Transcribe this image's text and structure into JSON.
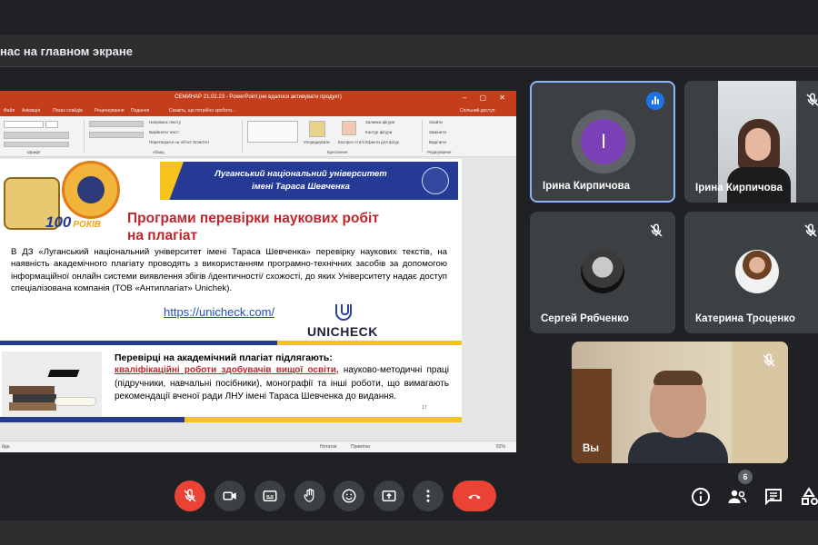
{
  "presentation_bar": {
    "text": "нас на главном экране"
  },
  "powerpoint": {
    "title": "СЕМИНАР 21.02.23 - PowerPoint (не вдалося активувати продукт)",
    "tabs": [
      "Файл",
      "Анімація",
      "Показ слайдів",
      "Рецензування",
      "Подання",
      "Скажіть, що потрібно зробити..."
    ],
    "share_label": "Спільний доступ",
    "ribbon": {
      "font_group": "Шрифт",
      "paragraph_group": "Абзац",
      "drawing_group": "Креслення",
      "editing_group": "Редагування",
      "arrange_label": "Упорядкувати",
      "styles_label": "Експрес-стилі",
      "text_direction": "Напрямок тексту",
      "align_text": "Вирівняти текст",
      "smartart": "Перетворити на об'єкт SmartArt",
      "fill": "Заливка фігури",
      "outline": "Контур фігури",
      "effects": "Ефекти для фігур",
      "find": "Знайти",
      "replace": "Замінити",
      "select": "Виділити"
    },
    "status": {
      "left": "йда",
      "notes": "Нотатки",
      "comments": "Примітки",
      "zoom": "82%"
    }
  },
  "slide": {
    "banner_line1": "Луганський національний університет",
    "banner_line2": "імені Тараса Шевченка",
    "hundred": "100",
    "years": "РОКІВ",
    "title_line1": "Програми перевірки наукових робіт",
    "title_line2": "на плагіат",
    "body": "В ДЗ «Луганський національний університет імені Тараса Шевченка» перевірку наукових текстів, на наявність академічного плагіату проводять з використанням програмно-технічних засобів за допомогою інформаційної онлайн системи виявлення збігів /ідентичності/ схожості, до яких Університету надає доступ спеціалізована компанія (ТОВ «Антиплагіат» Unichek).",
    "link": "https://unicheck.com/",
    "unicheck": "UNICHECK",
    "subheading": "Перевірці на академічний плагіат підлягають:",
    "red_text": "кваліфікаційні роботи здобувачів вищої освіти,",
    "body2": " науково-методичні праці (підручники, навчальні посібники), монографії та інші роботи, що вимагають рекомендації вченої ради ЛНУ імені Тараса Шевченка до видання.",
    "page_number": "17"
  },
  "participants": [
    {
      "name": "Ірина Кирпичова",
      "initial": "І",
      "speaking": true
    },
    {
      "name": "Ірина Кирпичова",
      "muted": true
    },
    {
      "name": "Сергей Рябченко",
      "muted": true
    },
    {
      "name": "Катерина Троценко",
      "muted": true
    },
    {
      "name": "Вы",
      "muted": true
    }
  ],
  "controls": {
    "participants_count": "6"
  },
  "colors": {
    "accent": "#8ab4f8",
    "danger": "#ea4335",
    "speaking": "#1a73e8",
    "ppt_red": "#c43e1c"
  }
}
